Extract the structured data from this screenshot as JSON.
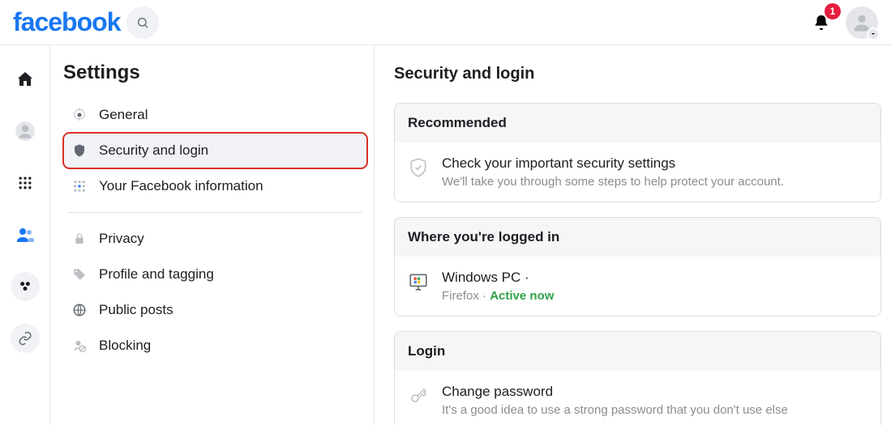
{
  "header": {
    "logo_text": "facebook",
    "notif_count": "1"
  },
  "sidebar": {
    "title": "Settings",
    "items": [
      {
        "label": "General"
      },
      {
        "label": "Security and login"
      },
      {
        "label": "Your Facebook information"
      },
      {
        "label": "Privacy"
      },
      {
        "label": "Profile and tagging"
      },
      {
        "label": "Public posts"
      },
      {
        "label": "Blocking"
      }
    ]
  },
  "main": {
    "title": "Security and login",
    "recommended": {
      "header": "Recommended",
      "row_title": "Check your important security settings",
      "row_sub": "We'll take you through some steps to help protect your account."
    },
    "where": {
      "header": "Where you're logged in",
      "device": "Windows PC",
      "separator": " · ",
      "browser": "Firefox · ",
      "status": "Active now"
    },
    "login": {
      "header": "Login",
      "row_title": "Change password",
      "row_sub": "It's a good idea to use a strong password that you don't use else"
    }
  }
}
